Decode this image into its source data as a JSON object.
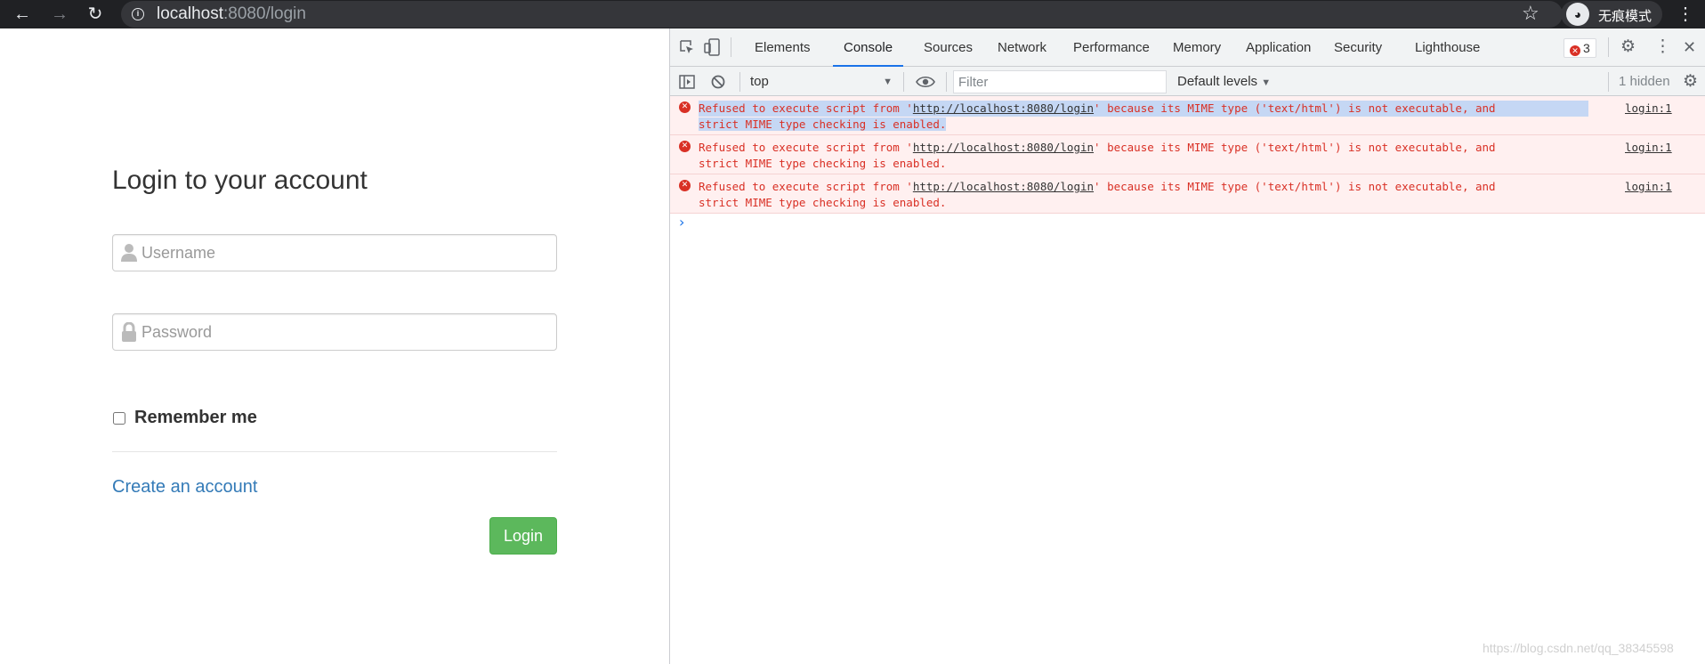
{
  "browser": {
    "url_host": "localhost",
    "url_path": ":8080/login",
    "incognito_label": "无痕模式",
    "icons": {
      "back": "arrow-left-icon",
      "forward": "arrow-right-icon",
      "reload": "reload-icon",
      "info": "info-icon",
      "bookmark": "star-icon",
      "incognito": "incognito-icon",
      "menu": "kebab-menu-icon"
    }
  },
  "login": {
    "title": "Login to your account",
    "username_placeholder": "Username",
    "password_placeholder": "Password",
    "remember_label": "Remember me",
    "remember_checked": false,
    "create_account_link": "Create an account",
    "login_button": "Login",
    "colors": {
      "link": "#337ab7",
      "button": "#5cb85c"
    }
  },
  "devtools": {
    "tabs": [
      {
        "label": "Elements",
        "active": false
      },
      {
        "label": "Console",
        "active": true
      },
      {
        "label": "Sources",
        "active": false
      },
      {
        "label": "Network",
        "active": false
      },
      {
        "label": "Performance",
        "active": false
      },
      {
        "label": "Memory",
        "active": false
      },
      {
        "label": "Application",
        "active": false
      },
      {
        "label": "Security",
        "active": false
      },
      {
        "label": "Lighthouse",
        "active": false
      }
    ],
    "error_count": "3",
    "context": "top",
    "filter_placeholder": "Filter",
    "levels_label": "Default levels",
    "hidden_label": "1 hidden",
    "messages": [
      {
        "prefix": "Refused to execute script from '",
        "url": "http://localhost:8080/login",
        "suffix": "' because its MIME type ('text/html') is not executable, and",
        "line2": "strict MIME type checking is enabled.",
        "source": "login:1",
        "selected": true
      },
      {
        "prefix": "Refused to execute script from '",
        "url": "http://localhost:8080/login",
        "suffix": "' because its MIME type ('text/html') is not executable, and",
        "line2": "strict MIME type checking is enabled.",
        "source": "login:1",
        "selected": false
      },
      {
        "prefix": "Refused to execute script from '",
        "url": "http://localhost:8080/login",
        "suffix": "' because its MIME type ('text/html') is not executable, and",
        "line2": "strict MIME type checking is enabled.",
        "source": "login:1",
        "selected": false
      }
    ],
    "colors": {
      "error_text": "#d93025",
      "error_bg": "#fff0f0",
      "active_tab": "#1a73e8"
    }
  },
  "watermark": "https://blog.csdn.net/qq_38345598"
}
